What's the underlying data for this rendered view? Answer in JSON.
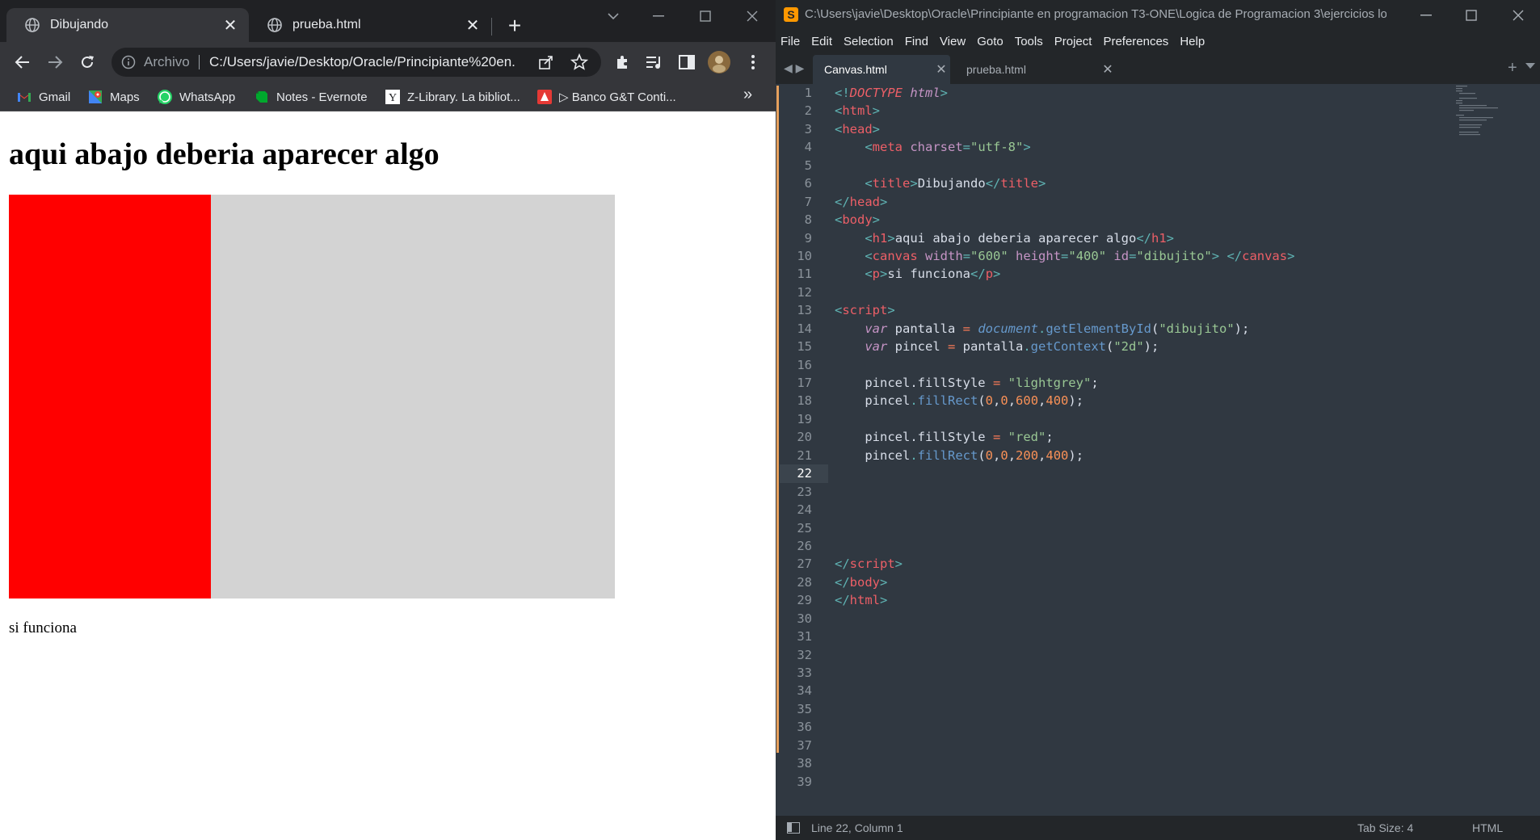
{
  "browser": {
    "tabs": [
      {
        "label": "Dibujando",
        "active": true
      },
      {
        "label": "prueba.html",
        "active": false
      }
    ],
    "address": {
      "scheme_label": "Archivo",
      "url": "C:/Users/javie/Desktop/Oracle/Principiante%20en..."
    },
    "bookmarks": [
      {
        "label": "Gmail",
        "icon": "gmail-icon"
      },
      {
        "label": "Maps",
        "icon": "maps-icon"
      },
      {
        "label": "WhatsApp",
        "icon": "whatsapp-icon"
      },
      {
        "label": "Notes - Evernote",
        "icon": "evernote-icon"
      },
      {
        "label": "Z-Library. La bibliot...",
        "icon": "zlibrary-icon"
      },
      {
        "label": "▷ Banco G&T Conti...",
        "icon": "bank-icon"
      }
    ],
    "more_bookmarks": "»",
    "page": {
      "heading": "aqui abajo deberia aparecer algo",
      "paragraph": "si funciona",
      "canvas_background": "#d3d3d3",
      "canvas_fill": "#ff0000"
    }
  },
  "editor": {
    "title_path": "C:\\Users\\javie\\Desktop\\Oracle\\Principiante en programacion T3-ONE\\Logica de Programacion 3\\ejercicios logi...",
    "menu": [
      "File",
      "Edit",
      "Selection",
      "Find",
      "View",
      "Goto",
      "Tools",
      "Project",
      "Preferences",
      "Help"
    ],
    "tabs": [
      {
        "label": "Canvas.html",
        "active": true
      },
      {
        "label": "prueba.html",
        "active": false
      }
    ],
    "current_line": 22,
    "line_count": 39,
    "status": {
      "position": "Line 22, Column 1",
      "tab_size": "Tab Size: 4",
      "syntax": "HTML"
    },
    "colors": {
      "accent": "#ff9800",
      "modified_marker": "#e6a05c",
      "background": "#303841"
    }
  }
}
